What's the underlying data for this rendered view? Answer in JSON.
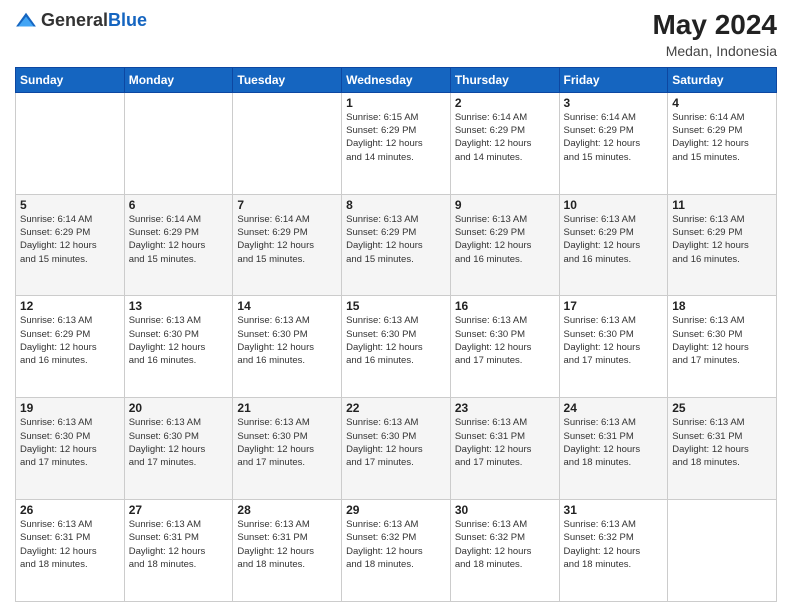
{
  "logo": {
    "text_general": "General",
    "text_blue": "Blue"
  },
  "header": {
    "month_year": "May 2024",
    "location": "Medan, Indonesia"
  },
  "weekdays": [
    "Sunday",
    "Monday",
    "Tuesday",
    "Wednesday",
    "Thursday",
    "Friday",
    "Saturday"
  ],
  "weeks": [
    [
      {
        "day": "",
        "info": ""
      },
      {
        "day": "",
        "info": ""
      },
      {
        "day": "",
        "info": ""
      },
      {
        "day": "1",
        "info": "Sunrise: 6:15 AM\nSunset: 6:29 PM\nDaylight: 12 hours\nand 14 minutes."
      },
      {
        "day": "2",
        "info": "Sunrise: 6:14 AM\nSunset: 6:29 PM\nDaylight: 12 hours\nand 14 minutes."
      },
      {
        "day": "3",
        "info": "Sunrise: 6:14 AM\nSunset: 6:29 PM\nDaylight: 12 hours\nand 15 minutes."
      },
      {
        "day": "4",
        "info": "Sunrise: 6:14 AM\nSunset: 6:29 PM\nDaylight: 12 hours\nand 15 minutes."
      }
    ],
    [
      {
        "day": "5",
        "info": "Sunrise: 6:14 AM\nSunset: 6:29 PM\nDaylight: 12 hours\nand 15 minutes."
      },
      {
        "day": "6",
        "info": "Sunrise: 6:14 AM\nSunset: 6:29 PM\nDaylight: 12 hours\nand 15 minutes."
      },
      {
        "day": "7",
        "info": "Sunrise: 6:14 AM\nSunset: 6:29 PM\nDaylight: 12 hours\nand 15 minutes."
      },
      {
        "day": "8",
        "info": "Sunrise: 6:13 AM\nSunset: 6:29 PM\nDaylight: 12 hours\nand 15 minutes."
      },
      {
        "day": "9",
        "info": "Sunrise: 6:13 AM\nSunset: 6:29 PM\nDaylight: 12 hours\nand 16 minutes."
      },
      {
        "day": "10",
        "info": "Sunrise: 6:13 AM\nSunset: 6:29 PM\nDaylight: 12 hours\nand 16 minutes."
      },
      {
        "day": "11",
        "info": "Sunrise: 6:13 AM\nSunset: 6:29 PM\nDaylight: 12 hours\nand 16 minutes."
      }
    ],
    [
      {
        "day": "12",
        "info": "Sunrise: 6:13 AM\nSunset: 6:29 PM\nDaylight: 12 hours\nand 16 minutes."
      },
      {
        "day": "13",
        "info": "Sunrise: 6:13 AM\nSunset: 6:30 PM\nDaylight: 12 hours\nand 16 minutes."
      },
      {
        "day": "14",
        "info": "Sunrise: 6:13 AM\nSunset: 6:30 PM\nDaylight: 12 hours\nand 16 minutes."
      },
      {
        "day": "15",
        "info": "Sunrise: 6:13 AM\nSunset: 6:30 PM\nDaylight: 12 hours\nand 16 minutes."
      },
      {
        "day": "16",
        "info": "Sunrise: 6:13 AM\nSunset: 6:30 PM\nDaylight: 12 hours\nand 17 minutes."
      },
      {
        "day": "17",
        "info": "Sunrise: 6:13 AM\nSunset: 6:30 PM\nDaylight: 12 hours\nand 17 minutes."
      },
      {
        "day": "18",
        "info": "Sunrise: 6:13 AM\nSunset: 6:30 PM\nDaylight: 12 hours\nand 17 minutes."
      }
    ],
    [
      {
        "day": "19",
        "info": "Sunrise: 6:13 AM\nSunset: 6:30 PM\nDaylight: 12 hours\nand 17 minutes."
      },
      {
        "day": "20",
        "info": "Sunrise: 6:13 AM\nSunset: 6:30 PM\nDaylight: 12 hours\nand 17 minutes."
      },
      {
        "day": "21",
        "info": "Sunrise: 6:13 AM\nSunset: 6:30 PM\nDaylight: 12 hours\nand 17 minutes."
      },
      {
        "day": "22",
        "info": "Sunrise: 6:13 AM\nSunset: 6:30 PM\nDaylight: 12 hours\nand 17 minutes."
      },
      {
        "day": "23",
        "info": "Sunrise: 6:13 AM\nSunset: 6:31 PM\nDaylight: 12 hours\nand 17 minutes."
      },
      {
        "day": "24",
        "info": "Sunrise: 6:13 AM\nSunset: 6:31 PM\nDaylight: 12 hours\nand 18 minutes."
      },
      {
        "day": "25",
        "info": "Sunrise: 6:13 AM\nSunset: 6:31 PM\nDaylight: 12 hours\nand 18 minutes."
      }
    ],
    [
      {
        "day": "26",
        "info": "Sunrise: 6:13 AM\nSunset: 6:31 PM\nDaylight: 12 hours\nand 18 minutes."
      },
      {
        "day": "27",
        "info": "Sunrise: 6:13 AM\nSunset: 6:31 PM\nDaylight: 12 hours\nand 18 minutes."
      },
      {
        "day": "28",
        "info": "Sunrise: 6:13 AM\nSunset: 6:31 PM\nDaylight: 12 hours\nand 18 minutes."
      },
      {
        "day": "29",
        "info": "Sunrise: 6:13 AM\nSunset: 6:32 PM\nDaylight: 12 hours\nand 18 minutes."
      },
      {
        "day": "30",
        "info": "Sunrise: 6:13 AM\nSunset: 6:32 PM\nDaylight: 12 hours\nand 18 minutes."
      },
      {
        "day": "31",
        "info": "Sunrise: 6:13 AM\nSunset: 6:32 PM\nDaylight: 12 hours\nand 18 minutes."
      },
      {
        "day": "",
        "info": ""
      }
    ]
  ]
}
